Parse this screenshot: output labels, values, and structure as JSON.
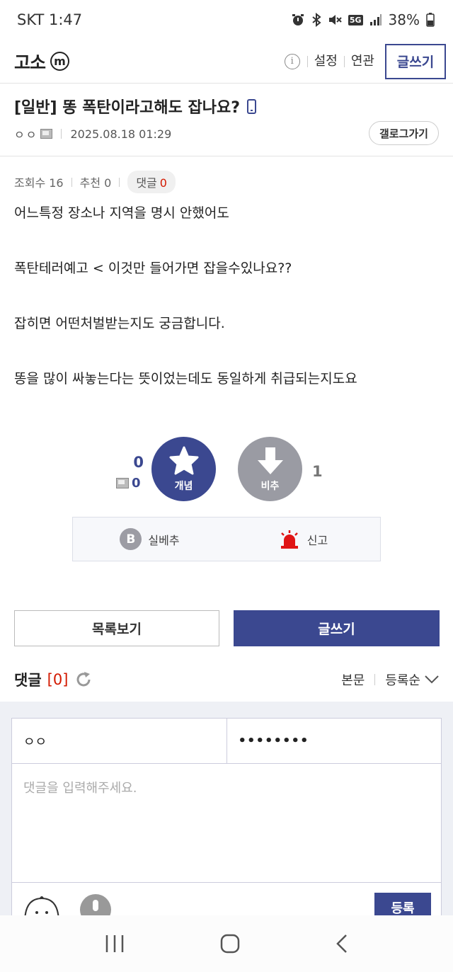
{
  "status_bar": {
    "carrier_time": "SKT 1:47",
    "battery": "38%",
    "network": "5G"
  },
  "header": {
    "gallery_name": "고소",
    "minor_badge": "m",
    "settings_label": "설정",
    "related_label": "연관",
    "write_label": "글쓰기"
  },
  "post": {
    "title": "[일반] 똥 폭탄이라고해도 잡나요?",
    "author": "ㅇㅇ",
    "date": "2025.08.18 01:29",
    "gallery_go_label": "갤로그가기",
    "views_label": "조회수 16",
    "recommend_label": "추천 0",
    "comment_label": "댓글",
    "comment_count": "0",
    "body": [
      "어느특정 장소나 지역을 명시 안했어도",
      "폭탄테러예고 < 이것만 들어가면 잡을수있나요??",
      "잡히면 어떤처벌받는지도 궁금합니다.",
      "똥을 많이 싸놓는다는 뜻이었는데도 동일하게 취급되는지도요"
    ]
  },
  "vote": {
    "up_count": "0",
    "fixed_up_count": "0",
    "up_label": "개념",
    "down_label": "비추",
    "down_count": "1"
  },
  "actions": {
    "realbest_label": "실베추",
    "b_letter": "B",
    "report_label": "신고"
  },
  "buttons": {
    "list_label": "목록보기",
    "write_label": "글쓰기"
  },
  "comments": {
    "title": "댓글",
    "count": "[0]",
    "filter_label": "본문",
    "sort_label": "등록순"
  },
  "comment_form": {
    "nickname_value": "ㅇㅇ",
    "password_value": "••••••••",
    "placeholder": "댓글을 입력해주세요.",
    "submit_label": "등록"
  },
  "colors": {
    "accent": "#3b4890",
    "comment_count": "#d31900",
    "downvote": "#9a9ba3"
  }
}
